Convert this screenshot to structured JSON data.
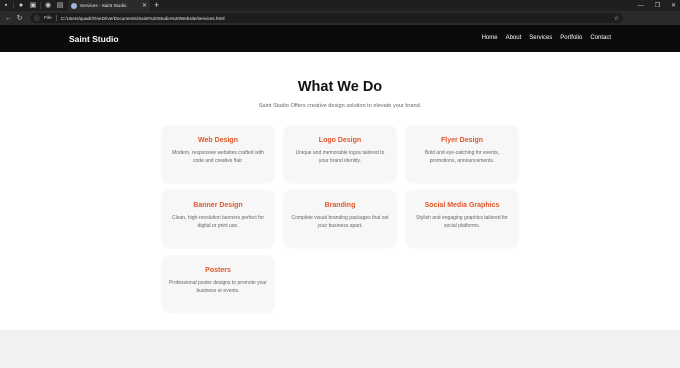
{
  "browser": {
    "tab_title": "Services - Saint Studio",
    "url_scheme_label": "File",
    "url": "C:/Users/quadr/OneDrive/Documents/Saint%20Studio%20Website/services.html"
  },
  "site": {
    "logo": "Saint Studio",
    "nav": [
      "Home",
      "About",
      "Services",
      "Portfolio",
      "Contact"
    ]
  },
  "section": {
    "title": "What We Do",
    "subtitle": "Saint Studio Offers creative design solution to elevate your brand."
  },
  "services": [
    {
      "title": "Web Design",
      "desc": "Modern, responsive websites crafted with code and creative flair."
    },
    {
      "title": "Logo Design",
      "desc": "Unique and memorable logos tailored to your brand identity."
    },
    {
      "title": "Flyer Design",
      "desc": "Bold and eye-catching for events, promotions, announcements."
    },
    {
      "title": "Banner Design",
      "desc": "Clean, high-resolution banners perfect for digital or print use."
    },
    {
      "title": "Branding",
      "desc": "Complete visual branding packages that set your business apart."
    },
    {
      "title": "Social Media Graphics",
      "desc": "Stylish and engaging graphics tailored for social platforms."
    },
    {
      "title": "Posters",
      "desc": "Professional poster designs to promote your business or events."
    }
  ],
  "colors": {
    "accent": "#e0582c",
    "header_bg": "#0b0b0b"
  }
}
